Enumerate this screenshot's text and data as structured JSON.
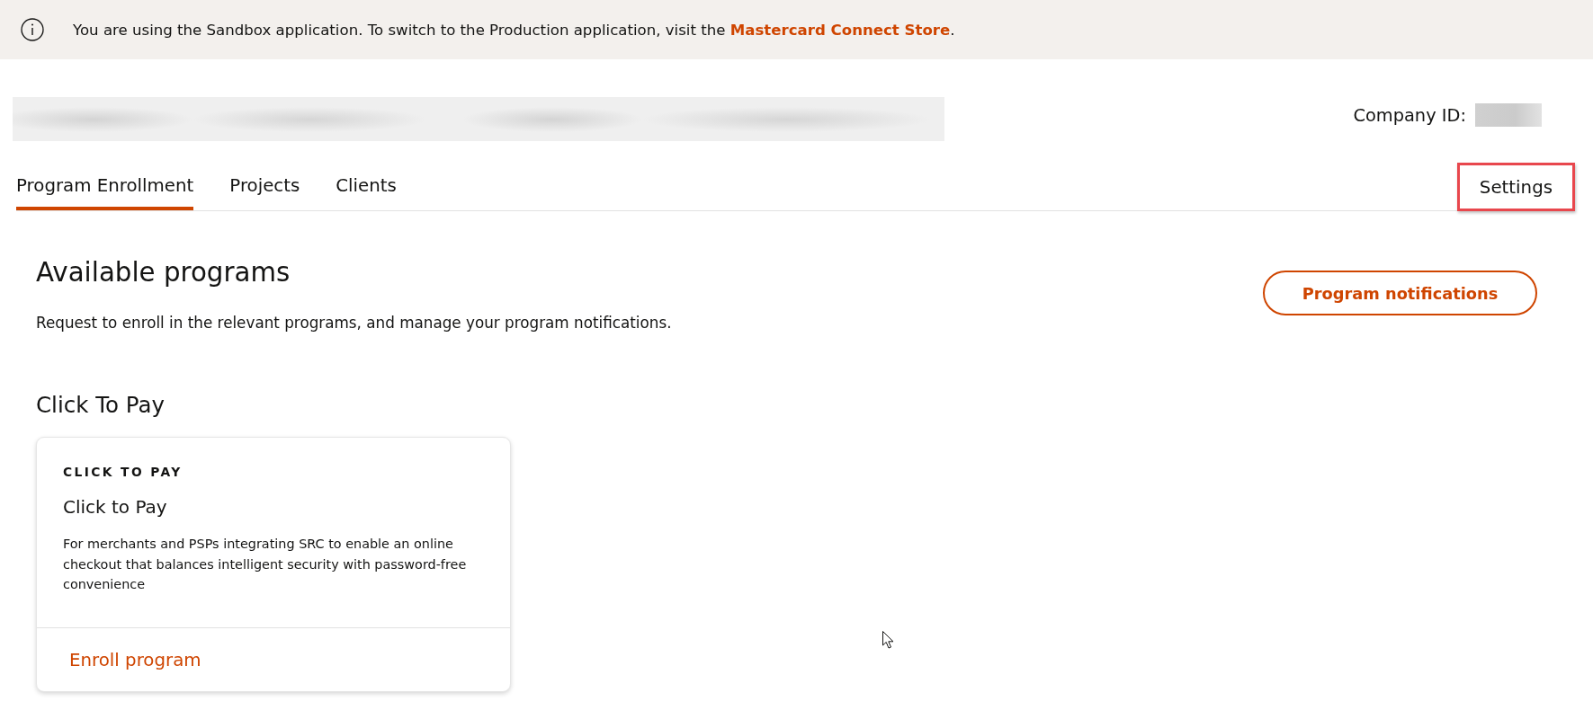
{
  "banner": {
    "message_start": "You are using the Sandbox application. To switch to the Production application, visit the ",
    "link": "Mastercard Connect Store",
    "message_end": "."
  },
  "header": {
    "company_id_label": "Company ID:"
  },
  "tabs": [
    {
      "label": "Program Enrollment",
      "selected": true
    },
    {
      "label": "Projects",
      "selected": false
    },
    {
      "label": "Clients",
      "selected": false
    }
  ],
  "settings": {
    "label": "Settings",
    "highlighted": true
  },
  "intro": {
    "title": "Available programs",
    "description": "Request to enroll in the relevant programs, and manage your program notifications.",
    "button": "Program notifications"
  },
  "sections": [
    {
      "title": "Click To Pay",
      "cards": [
        {
          "eyebrow": "CLICK TO PAY",
          "title": "Click to Pay",
          "description": "For merchants and PSPs integrating SRC to enable an online checkout that balances intelligent security with password-free convenience",
          "action": "Enroll program"
        }
      ]
    }
  ]
}
